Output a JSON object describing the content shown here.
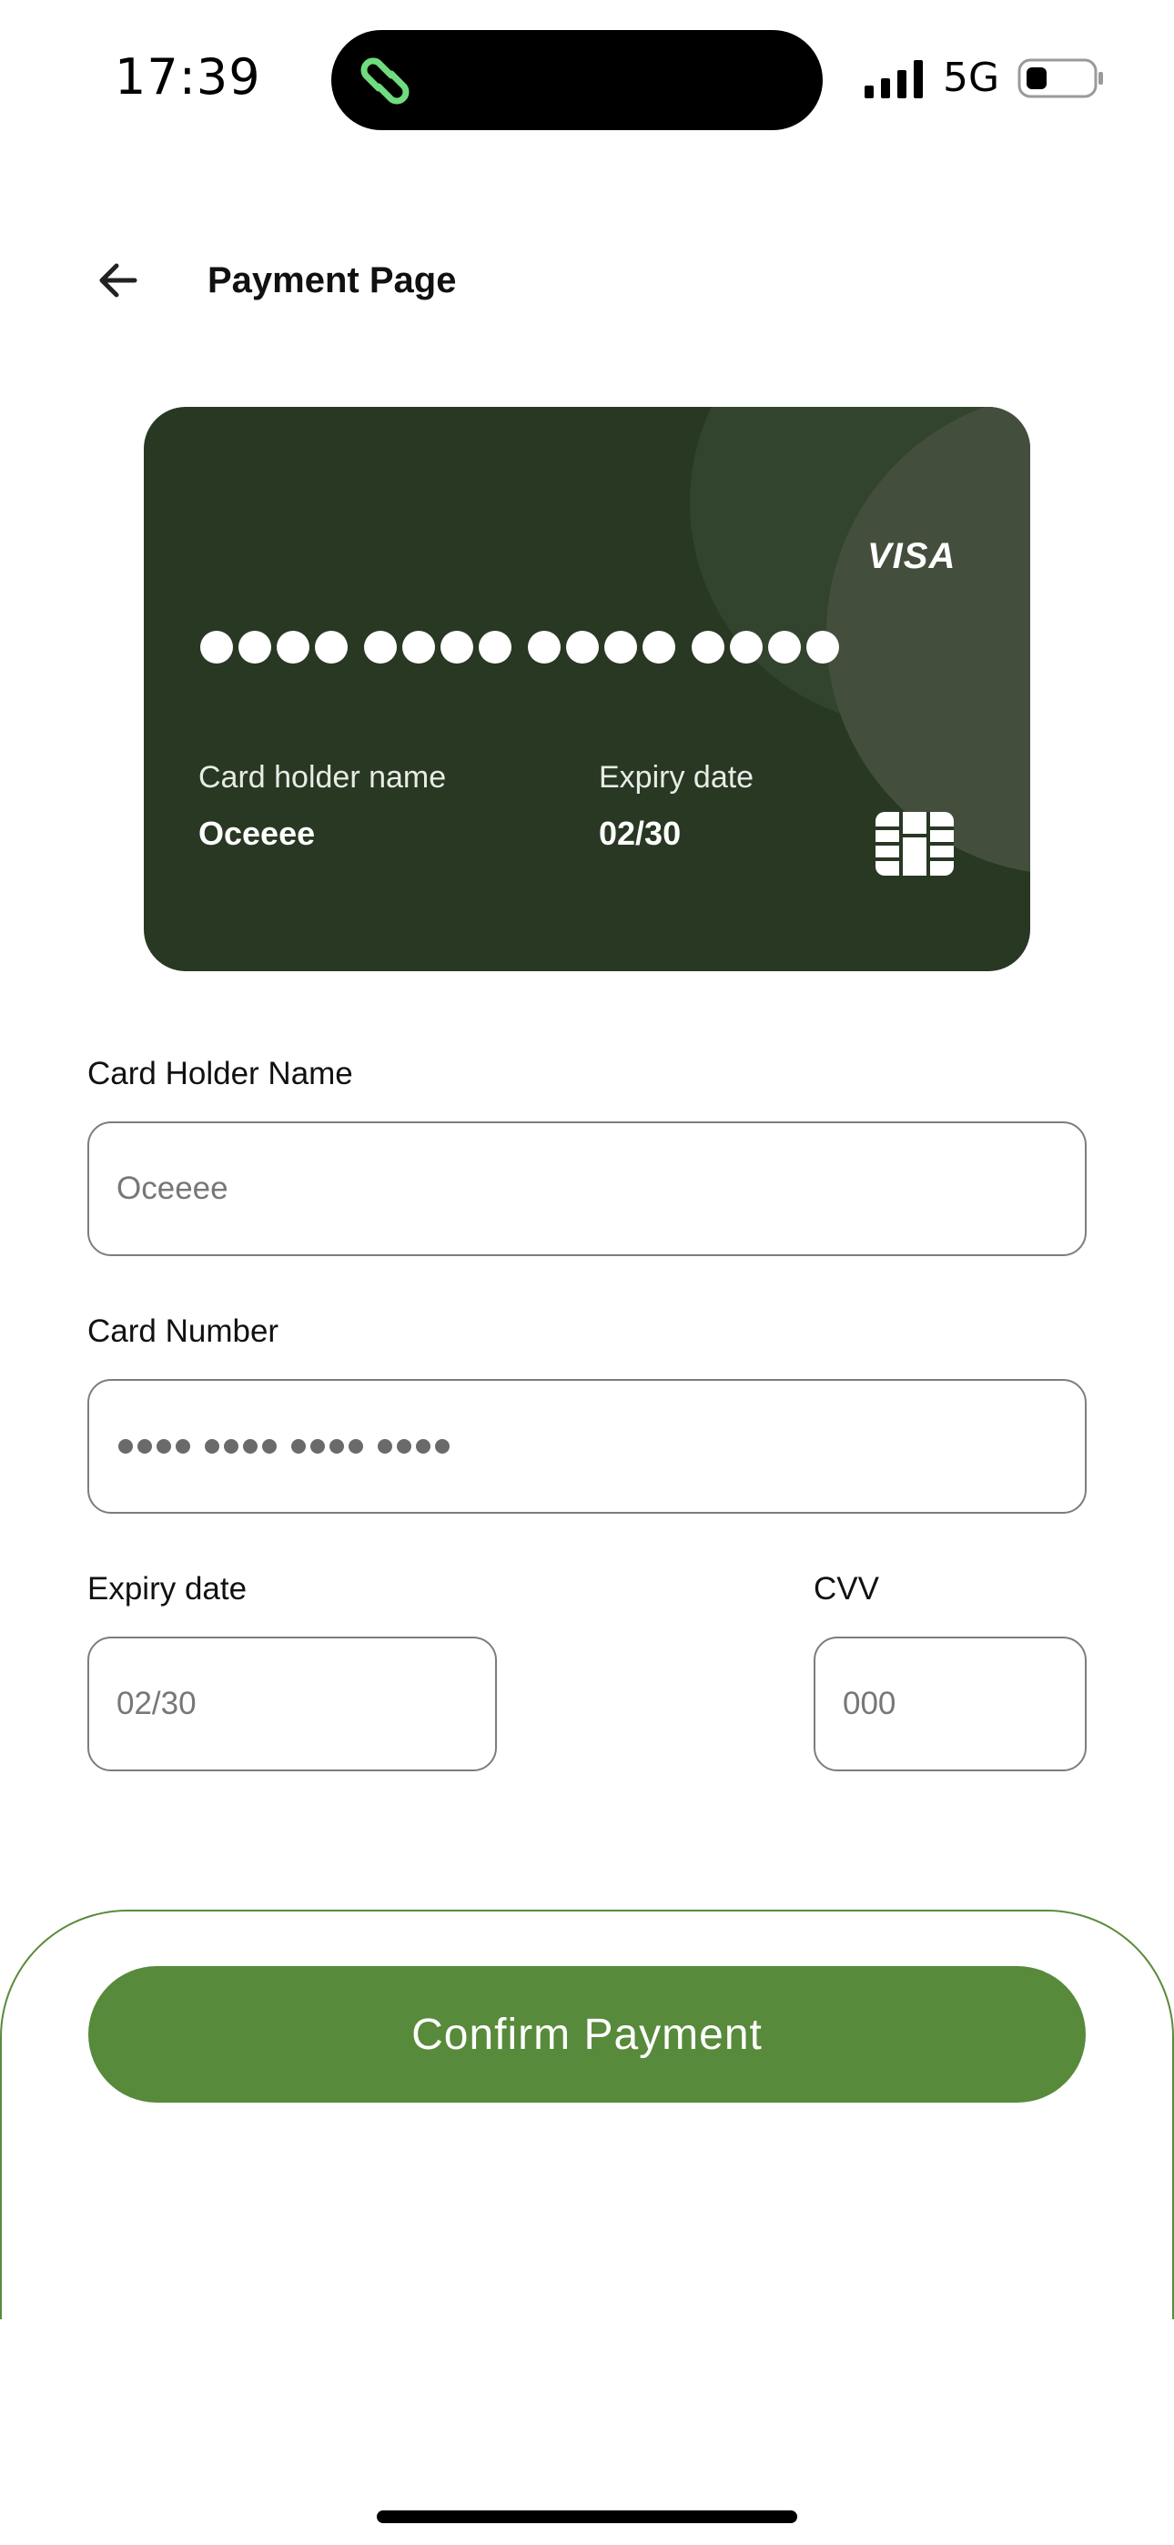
{
  "status_bar": {
    "time": "17:39",
    "network": "5G",
    "icons": [
      "link-icon",
      "signal-icon",
      "battery-icon"
    ]
  },
  "header": {
    "title": "Payment Page",
    "back_icon": "arrow-left-icon"
  },
  "card": {
    "brand": "VISA",
    "number_masked": "•••• •••• •••• ••••",
    "holder_label": "Card holder name",
    "holder_value": "Oceeee",
    "expiry_label": "Expiry date",
    "expiry_value": "02/30",
    "colors": {
      "background": "#283823",
      "accent": "#434f3c"
    }
  },
  "form": {
    "holder": {
      "label": "Card Holder Name",
      "placeholder": "Oceeee"
    },
    "number": {
      "label": "Card Number",
      "placeholder": "•••• •••• •••• ••••"
    },
    "expiry": {
      "label": "Expiry date",
      "placeholder": "02/30"
    },
    "cvv": {
      "label": "CVV",
      "placeholder": "000"
    }
  },
  "action": {
    "confirm_label": "Confirm Payment",
    "color": "#578a3a"
  }
}
